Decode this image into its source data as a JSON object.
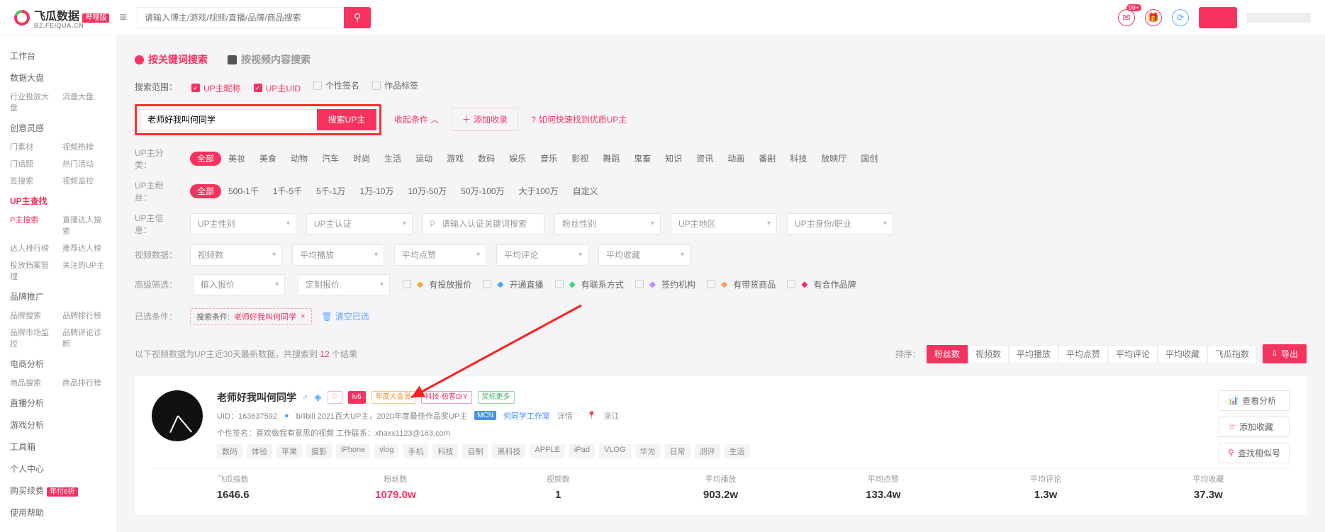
{
  "top": {
    "brand": "飞瓜数据",
    "brand_sub": "BZ.FEIQUA.CN",
    "brand_badge": "哔哩版",
    "search_placeholder": "请输入博主/游戏/视频/直播/品牌/商品搜索",
    "msg_badge": "99+"
  },
  "sidebar": {
    "sections": [
      {
        "title": "工作台",
        "links": []
      },
      {
        "title": "数据大盘",
        "links": [
          "行业投放大盘",
          "流量大盘"
        ]
      },
      {
        "title": "创意灵感",
        "links": [
          "门素材",
          "视频热榜",
          "门话题",
          "热门活动",
          "签搜索",
          "视频监控"
        ]
      },
      {
        "title": "UP主查找",
        "hot": true,
        "links": [
          "P主搜索",
          "直播达人搜索",
          "达人排行榜",
          "推荐达人榜",
          "投放档案管理",
          "关注的UP主"
        ],
        "hotIdx": 0
      },
      {
        "title": "品牌推广",
        "links": [
          "品牌搜索",
          "品牌排行榜",
          "品牌市场监控",
          "品牌评论诊断"
        ]
      },
      {
        "title": "电商分析",
        "links": [
          "商品搜索",
          "商品排行榜"
        ]
      },
      {
        "title": "直播分析",
        "links": []
      },
      {
        "title": "游戏分析",
        "links": []
      },
      {
        "title": "工具箱",
        "links": []
      },
      {
        "title": "个人中心",
        "links": []
      },
      {
        "title": "购买续费",
        "links": [],
        "badge": "年付6折"
      },
      {
        "title": "使用帮助",
        "links": []
      }
    ]
  },
  "tabs": {
    "a": "按关键词搜索",
    "b": "按视频内容搜索"
  },
  "scope": {
    "label": "搜索范围：",
    "items": [
      {
        "t": "UP主昵称",
        "c": true
      },
      {
        "t": "UP主UID",
        "c": true
      },
      {
        "t": "个性签名",
        "c": false
      },
      {
        "t": "作品标签",
        "c": false
      }
    ]
  },
  "searchbar": {
    "value": "老师好我叫何同学",
    "btn": "搜索UP主",
    "toggle": "收起条件",
    "add": "添加收录",
    "help": "如何快速找到优质UP主"
  },
  "filters": {
    "cat": {
      "label": "UP主分类：",
      "items": [
        "全部",
        "美妆",
        "美食",
        "动物",
        "汽车",
        "时尚",
        "生活",
        "运动",
        "游戏",
        "数码",
        "娱乐",
        "音乐",
        "影视",
        "舞蹈",
        "鬼畜",
        "知识",
        "资讯",
        "动画",
        "番剧",
        "科技",
        "放映厅",
        "国创"
      ]
    },
    "fans": {
      "label": "UP主粉丝：",
      "items": [
        "全部",
        "500-1千",
        "1千-5千",
        "5千-1万",
        "1万-10万",
        "10万-50万",
        "50万-100万",
        "大于100万",
        "自定义"
      ]
    },
    "info": {
      "label": "UP主信息：",
      "sels": [
        "UP主性别",
        "UP主认证"
      ],
      "search_ph": "请输入认证关键词搜索",
      "more": [
        "粉丝性别",
        "UP主地区",
        "UP主身份/职业"
      ]
    },
    "video": {
      "label": "视频数据：",
      "sels": [
        "视频数",
        "平均播放",
        "平均点赞",
        "平均评论",
        "平均收藏"
      ]
    },
    "adv": {
      "label": "高级筛选：",
      "sels": [
        "植入报价",
        "定制报价"
      ],
      "checks": [
        {
          "t": "有投放报价",
          "c": "#f9a23a"
        },
        {
          "t": "开通直播",
          "c": "#4aa7ff"
        },
        {
          "t": "有联系方式",
          "c": "#3dd27a"
        },
        {
          "t": "签约机构",
          "c": "#c28bff"
        },
        {
          "t": "有带货商品",
          "c": "#ff9a5a"
        },
        {
          "t": "有合作品牌",
          "c": "#f6325f"
        }
      ]
    }
  },
  "chosen": {
    "label": "已选条件：",
    "prefix": "搜索条件:",
    "value": "老师好我叫何同学",
    "clear": "清空已选"
  },
  "meta": {
    "prefix": "以下视频数据为UP主近30天最新数据，共搜索到 ",
    "count": "12",
    "suffix": " 个结果"
  },
  "sort": {
    "label": "排序：",
    "items": [
      "粉丝数",
      "视频数",
      "平均播放",
      "平均点赞",
      "平均评论",
      "平均收藏",
      "飞瓜指数"
    ],
    "export": "导出"
  },
  "result": {
    "name": "老师好我叫何同学",
    "badges": {
      "lv": "lv6",
      "annual": "年度大会员",
      "tech": "科技·极客DIY",
      "more": "奖标更多"
    },
    "uid_line": {
      "uid": "UID：163637592",
      "dot": "●",
      "bili": "bilibili 2021百大UP主，2020年度最佳作品奖UP主",
      "mcn_tag": "MCN",
      "mcn": "何同学工作室",
      "detail": "详情",
      "loc": "浙江"
    },
    "sig": "个性签名：喜欢做我有意思的视频 工作联系：xhaxx1123@163.com",
    "tags": [
      "数码",
      "体验",
      "苹果",
      "摄影",
      "iPhone",
      "vlog",
      "手机",
      "科技",
      "自制",
      "黑科技",
      "APPLE",
      "iPad",
      "VLOG",
      "华为",
      "日常",
      "测评",
      "生活"
    ],
    "actions": {
      "view": "查看分析",
      "fav": "添加收藏",
      "sim": "查找相似号"
    },
    "stats": [
      {
        "k": "飞瓜指数",
        "v": "1646.6"
      },
      {
        "k": "粉丝数",
        "v": "1079.0w",
        "hot": true
      },
      {
        "k": "视频数",
        "v": "1"
      },
      {
        "k": "平均播放",
        "v": "903.2w"
      },
      {
        "k": "平均点赞",
        "v": "133.4w"
      },
      {
        "k": "平均评论",
        "v": "1.3w"
      },
      {
        "k": "平均收藏",
        "v": "37.3w"
      }
    ]
  }
}
